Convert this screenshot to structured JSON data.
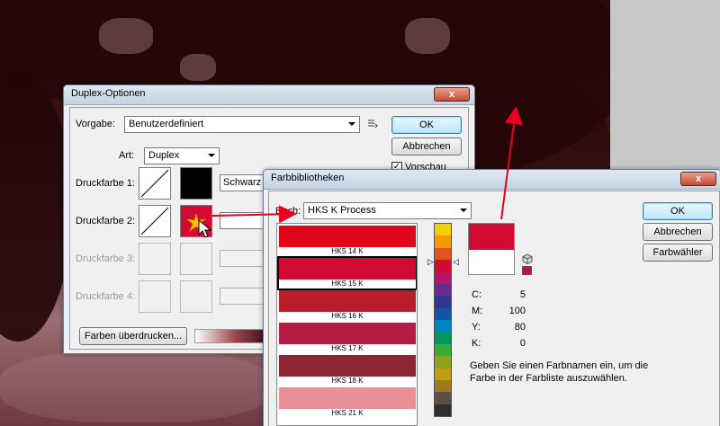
{
  "duplex": {
    "title": "Duplex-Optionen",
    "preset_label": "Vorgabe:",
    "preset_value": "Benutzerdefiniert",
    "type_label": "Art:",
    "type_value": "Duplex",
    "ink1_label": "Druckfarbe 1:",
    "ink1_name": "Schwarz",
    "ink2_label": "Druckfarbe 2:",
    "ink3_label": "Druckfarbe 3:",
    "ink4_label": "Druckfarbe 4:",
    "ok": "OK",
    "cancel": "Abbrechen",
    "preview": "Vorschau",
    "overprint": "Farben überdrucken...",
    "close": "x"
  },
  "library": {
    "title": "Farbbibliotheken",
    "book_label": "Buch:",
    "book_value": "HKS K Process",
    "ok": "OK",
    "cancel": "Abbrechen",
    "picker": "Farbwähler",
    "close": "x",
    "swatches": [
      {
        "name": "HKS 14 K",
        "color": "#e0061a"
      },
      {
        "name": "HKS 15 K",
        "color": "#d10a33"
      },
      {
        "name": "HKS 16 K",
        "color": "#b91f2b"
      },
      {
        "name": "HKS 17 K",
        "color": "#b41e45"
      },
      {
        "name": "HKS 18 K",
        "color": "#8c2632"
      },
      {
        "name": "HKS 21 K",
        "color": "#ec8e96"
      }
    ],
    "cmyk": [
      {
        "label": "C:",
        "value": "5"
      },
      {
        "label": "M:",
        "value": "100"
      },
      {
        "label": "Y:",
        "value": "80"
      },
      {
        "label": "K:",
        "value": "0"
      }
    ],
    "hint": "Geben Sie einen Farbnamen ein, um die Farbe in der Farbliste auszuwählen.",
    "new_color": "#d10a33",
    "old_color": "#ffffff",
    "hue_colors": [
      "#f4d000",
      "#f29a00",
      "#e3531b",
      "#d10a33",
      "#b3156a",
      "#6a2a8a",
      "#31388f",
      "#1055a3",
      "#0082c5",
      "#00975c",
      "#3aa935",
      "#8ca21c",
      "#c09b18",
      "#a07a1e",
      "#5a5048",
      "#2f2f2f"
    ]
  },
  "colors": {
    "accent_red": "#e6001f",
    "ink1": "#000000",
    "ink2": "#d10a33"
  }
}
